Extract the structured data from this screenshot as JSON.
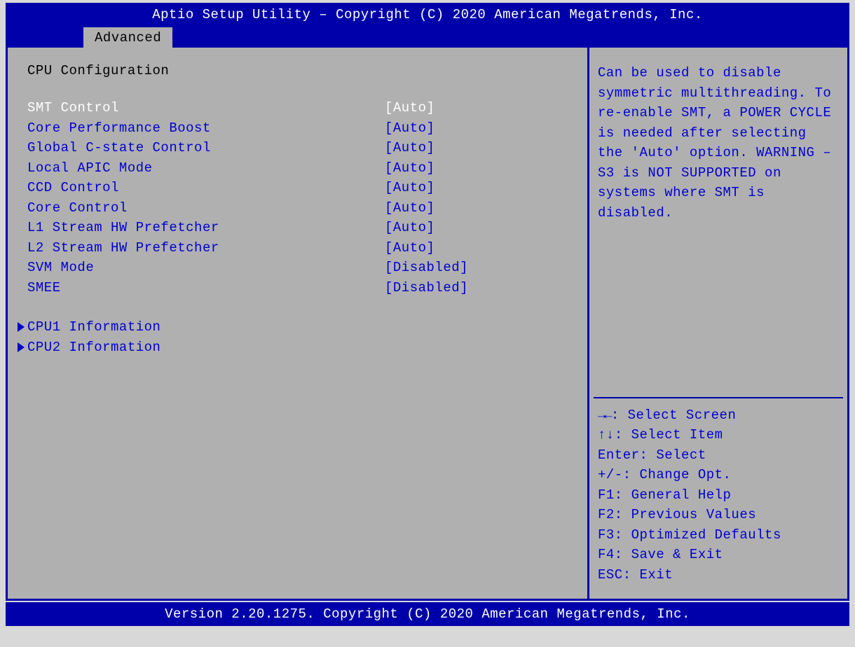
{
  "header": {
    "title": "Aptio Setup Utility – Copyright (C) 2020 American Megatrends, Inc."
  },
  "tab": {
    "label": "Advanced"
  },
  "page": {
    "section_title": "CPU Configuration",
    "settings": [
      {
        "label": "SMT Control",
        "value": "[Auto]",
        "selected": true
      },
      {
        "label": "Core Performance Boost",
        "value": "[Auto]",
        "selected": false
      },
      {
        "label": "Global C-state Control",
        "value": "[Auto]",
        "selected": false
      },
      {
        "label": "Local APIC Mode",
        "value": "[Auto]",
        "selected": false
      },
      {
        "label": "CCD Control",
        "value": "[Auto]",
        "selected": false
      },
      {
        "label": "Core Control",
        "value": "[Auto]",
        "selected": false
      },
      {
        "label": "L1 Stream HW Prefetcher",
        "value": "[Auto]",
        "selected": false
      },
      {
        "label": "L2 Stream HW Prefetcher",
        "value": "[Auto]",
        "selected": false
      },
      {
        "label": "SVM Mode",
        "value": "[Disabled]",
        "selected": false
      },
      {
        "label": "SMEE",
        "value": "[Disabled]",
        "selected": false
      }
    ],
    "submenus": [
      {
        "label": "CPU1 Information"
      },
      {
        "label": "CPU2 Information"
      }
    ]
  },
  "help": {
    "text": "Can be used to disable symmetric multithreading. To re-enable SMT, a POWER CYCLE is needed after selecting the 'Auto' option. WARNING – S3 is NOT SUPPORTED on systems where SMT is disabled."
  },
  "keys": {
    "lr_icon": "→←",
    "lr_label": ": Select Screen",
    "ud_icon": "↑↓",
    "ud_label": ": Select Item",
    "enter": "Enter: Select",
    "plusminus": "+/-: Change Opt.",
    "f1": "F1: General Help",
    "f2": "F2: Previous Values",
    "f3": "F3: Optimized Defaults",
    "f4": "F4: Save & Exit",
    "esc": "ESC: Exit"
  },
  "footer": {
    "text": "Version 2.20.1275. Copyright (C) 2020 American Megatrends, Inc."
  }
}
